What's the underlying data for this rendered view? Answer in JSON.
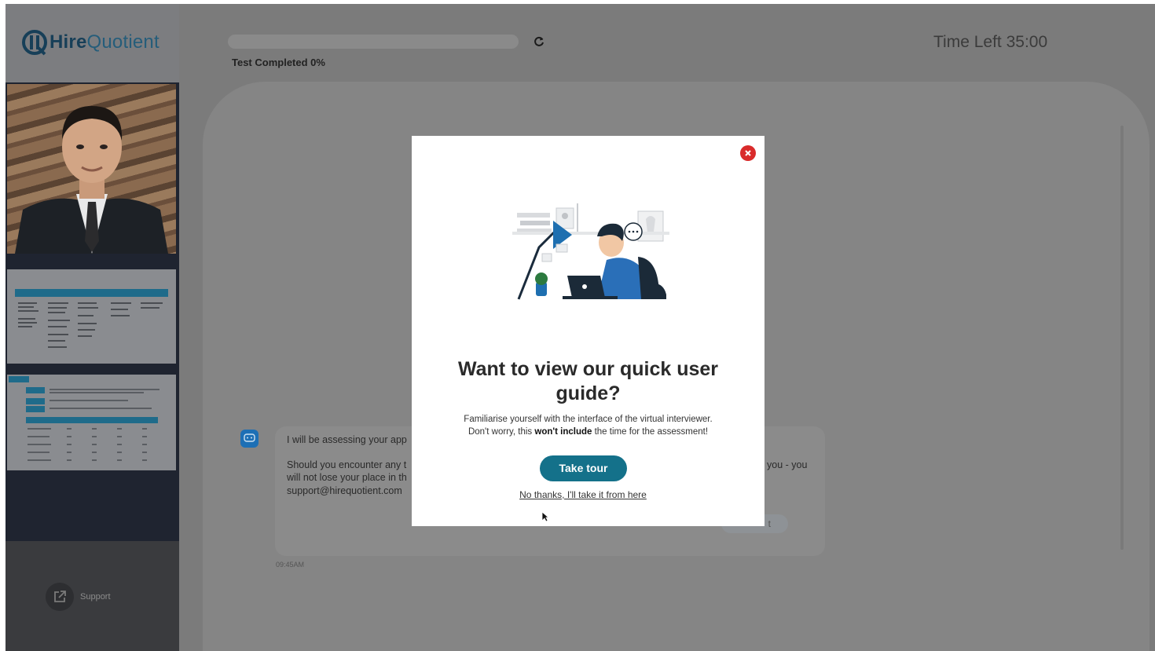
{
  "brand": {
    "name_bold": "Hire",
    "name_light": "Quotient"
  },
  "header": {
    "progress_label": "Test Completed 0%",
    "progress_fraction": 0.0,
    "timer_label": "Time Left",
    "timer_value": "35:00"
  },
  "sidebar": {
    "support_label": "Support"
  },
  "chat": {
    "line1": "I will be assessing your app",
    "line2a": "Should you encounter any t",
    "line2b": "will not lose your place in th",
    "line2c": "support@hirequotient.com",
    "line2d": "you - you",
    "ghost_btn": "t",
    "time": "09:45AM"
  },
  "modal": {
    "title": "Want to view our quick user guide?",
    "body_line1": "Familiarise yourself with the interface of the virtual interviewer.",
    "body_pre": "Don't worry, this ",
    "body_bold": "won't include",
    "body_post": " the time for the assessment!",
    "primary_button": "Take tour",
    "secondary_link": "No thanks, I'll take it from here"
  },
  "colors": {
    "accent": "#14718a",
    "close": "#d92b2b",
    "brand": "#1a4f6b"
  },
  "icons": [
    "logo-mark-icon",
    "refresh-icon",
    "close-icon",
    "chat-bot-icon",
    "external-link-icon",
    "cursor-icon"
  ]
}
